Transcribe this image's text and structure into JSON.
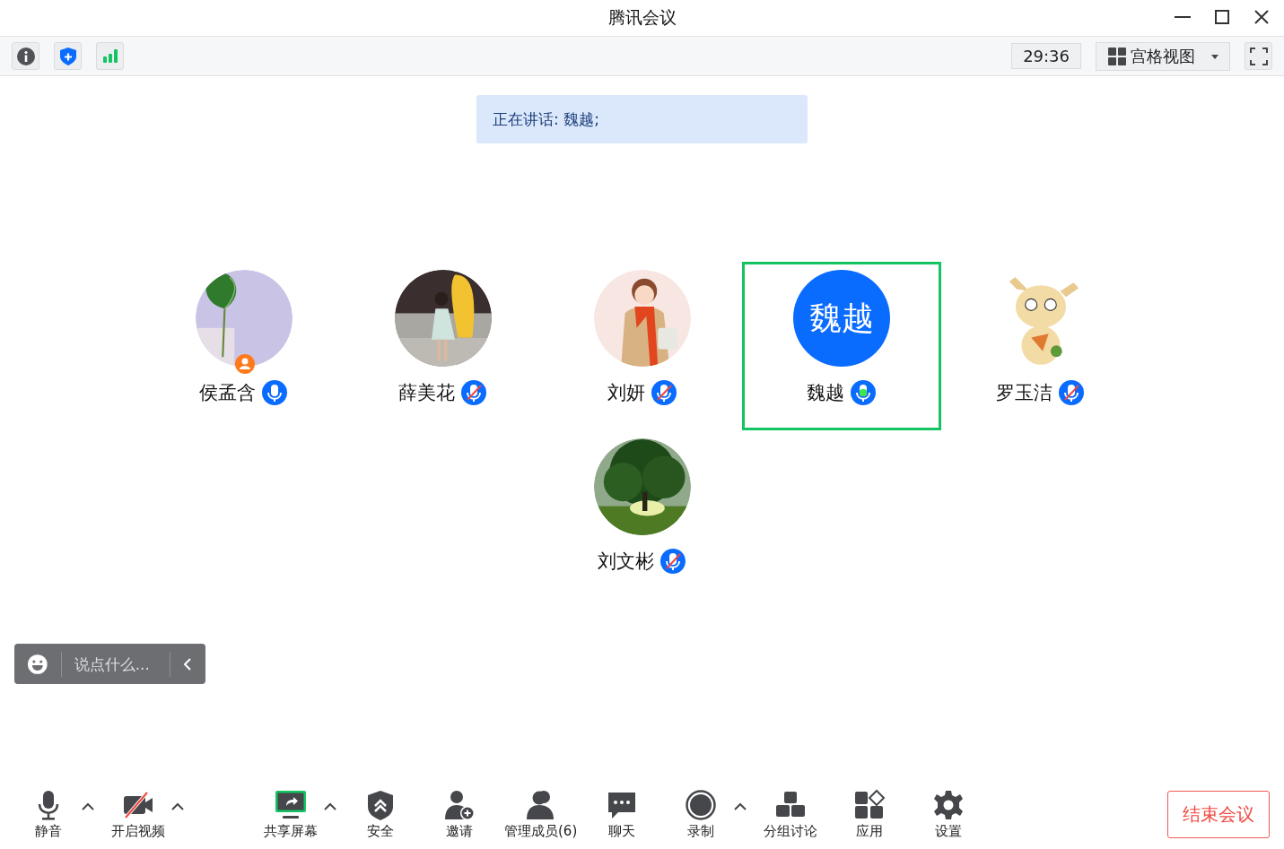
{
  "window": {
    "title": "腾讯会议"
  },
  "top_bar": {
    "timer": "29:36",
    "view_button": "宫格视图"
  },
  "speaker_banner": "正在讲话: 魏越;",
  "participants": [
    {
      "name": "侯孟含",
      "host": true,
      "muted": false,
      "speaking": false
    },
    {
      "name": "薛美花",
      "host": false,
      "muted": true,
      "speaking": false
    },
    {
      "name": "刘妍",
      "host": false,
      "muted": true,
      "speaking": false
    },
    {
      "name": "魏越",
      "avatar": {
        "kind": "initials",
        "text": "魏越"
      },
      "host": false,
      "muted": false,
      "speaking": true
    },
    {
      "name": "罗玉洁",
      "host": false,
      "muted": true,
      "speaking": false
    },
    {
      "name": "刘文彬",
      "host": false,
      "muted": true,
      "speaking": false
    }
  ],
  "chat_input": {
    "placeholder": "说点什么..."
  },
  "toolbar": [
    {
      "kind": "mic",
      "label": "静音",
      "caret": true
    },
    {
      "kind": "video-off",
      "label": "开启视频",
      "caret": true
    },
    {
      "kind": "share",
      "label": "共享屏幕",
      "caret": true
    },
    {
      "kind": "security",
      "label": "安全",
      "caret": false
    },
    {
      "kind": "invite",
      "label": "邀请",
      "caret": false
    },
    {
      "kind": "members",
      "label": "管理成员(6)",
      "caret": false
    },
    {
      "kind": "chat",
      "label": "聊天",
      "caret": false
    },
    {
      "kind": "record",
      "label": "录制",
      "caret": true
    },
    {
      "kind": "breakout",
      "label": "分组讨论",
      "caret": false
    },
    {
      "kind": "apps",
      "label": "应用",
      "caret": false
    },
    {
      "kind": "settings",
      "label": "设置",
      "caret": false
    }
  ],
  "end_button": "结束会议"
}
